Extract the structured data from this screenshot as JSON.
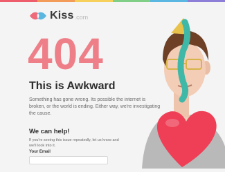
{
  "topbar_colors": [
    "#ee5d6c",
    "#f39b58",
    "#f7d05c",
    "#7fcf86",
    "#5ab7e2",
    "#8d7ed8"
  ],
  "brand": {
    "name": "Kiss",
    "tld": ".com",
    "colors": {
      "left": "#ee6b7a",
      "right": "#5bb6e0"
    }
  },
  "error": {
    "code": "404",
    "title": "This is Awkward",
    "description": "Something has gone wrong. Its possible the internet is broken, or the world is ending. Either way, we're investigating the cause."
  },
  "help": {
    "title": "We can help!",
    "text": "If you're seeing this issue repeatedly, let us know and we'll look into it.",
    "email_label": "Your Email",
    "email_value": "",
    "email_placeholder": ""
  },
  "accent_color": "#ee7f88",
  "illustration": {
    "subject": "person-with-party-hat-and-heart-balloon",
    "balloon_color": "#ef3f56"
  }
}
